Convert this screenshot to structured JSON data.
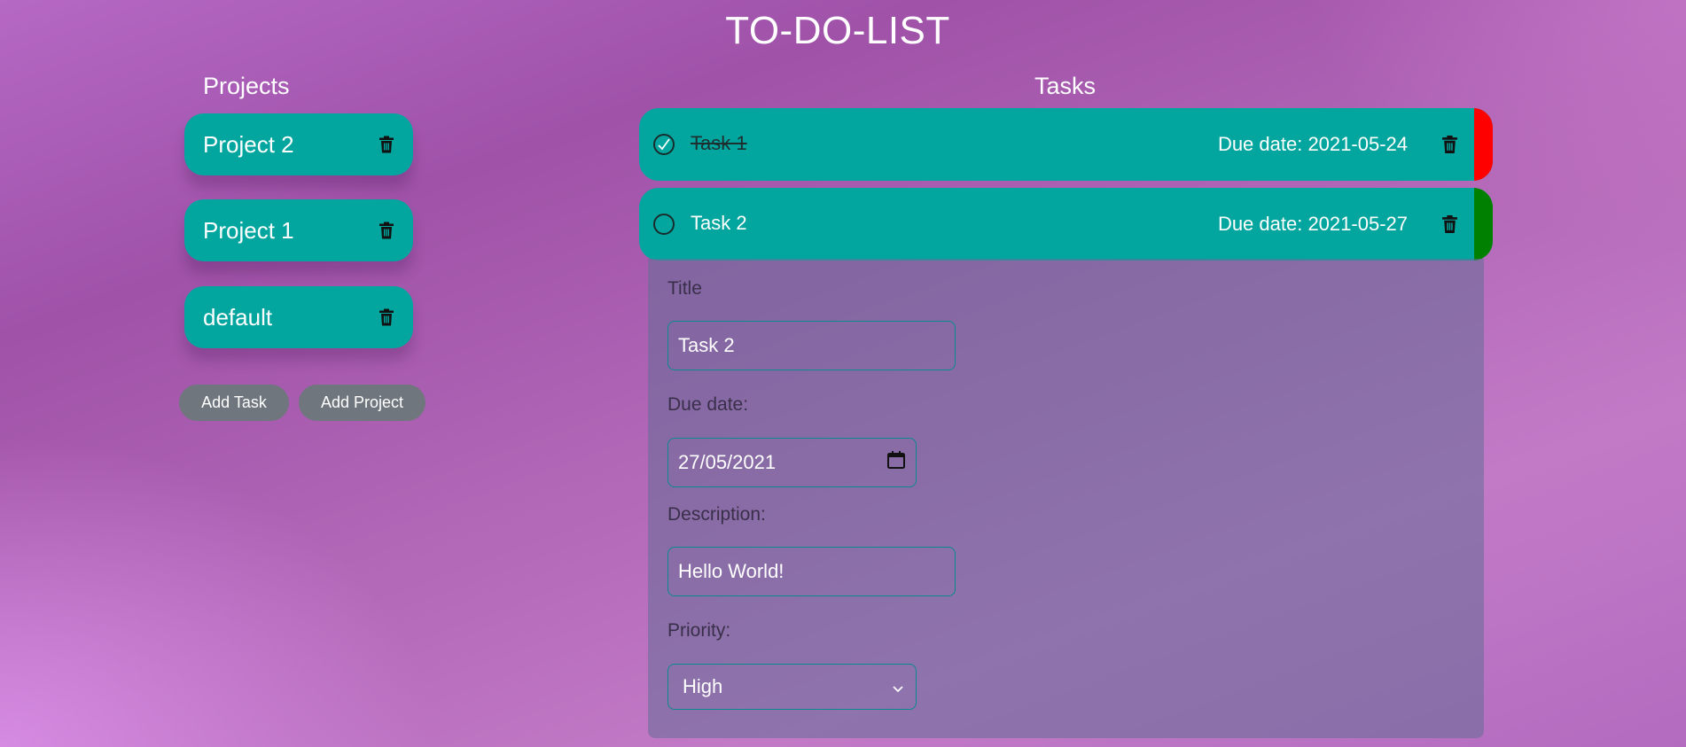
{
  "app": {
    "title": "TO-DO-LIST"
  },
  "projects": {
    "heading": "Projects",
    "items": [
      {
        "label": "Project 2"
      },
      {
        "label": "Project 1"
      },
      {
        "label": "default"
      }
    ]
  },
  "actions": {
    "add_task": "Add Task",
    "add_project": "Add Project"
  },
  "tasks": {
    "heading": "Tasks",
    "items": [
      {
        "title": "Task 1",
        "due": "Due date: 2021-05-24",
        "completed": true,
        "priority_color": "#ff0000"
      },
      {
        "title": "Task 2",
        "due": "Due date: 2021-05-27",
        "completed": false,
        "priority_color": "#008000"
      }
    ]
  },
  "task_form": {
    "title_label": "Title",
    "title_value": "Task 2",
    "due_label": "Due date:",
    "due_value": "27/05/2021",
    "description_label": "Description:",
    "description_value": "Hello World!",
    "priority_label": "Priority:",
    "priority_value": "High"
  },
  "colors": {
    "accent": "#03a69f",
    "button_gray": "#6f767d",
    "priority_high": "#ff0000",
    "priority_low": "#008000"
  },
  "icons": {
    "delete": "trash-icon",
    "complete": "check-circle-icon",
    "calendar": "calendar-icon",
    "dropdown": "chevron-down-icon"
  }
}
